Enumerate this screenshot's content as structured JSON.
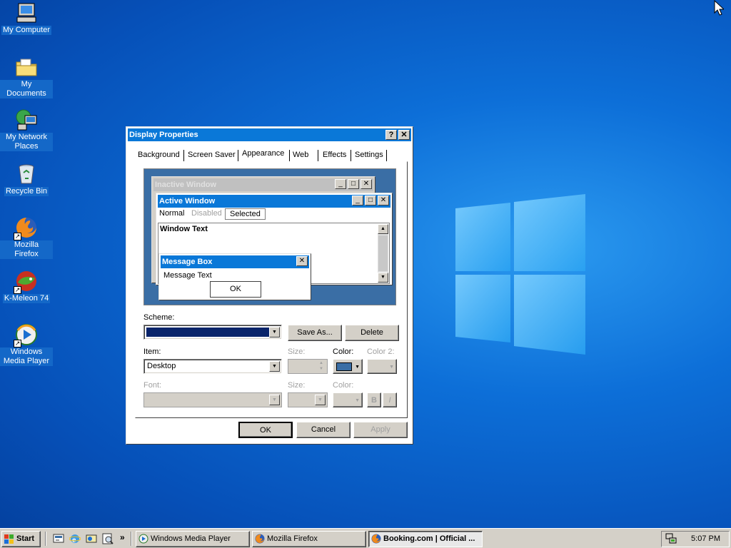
{
  "desktop": {
    "icons": [
      {
        "label": "My Computer",
        "icon": "computer-icon"
      },
      {
        "label": "My Documents",
        "icon": "folder-icon"
      },
      {
        "label": "My Network Places",
        "icon": "network-icon"
      },
      {
        "label": "Recycle Bin",
        "icon": "recycle-bin-icon"
      },
      {
        "label": "Mozilla Firefox",
        "icon": "firefox-icon"
      },
      {
        "label": "K-Meleon 74",
        "icon": "k-meleon-icon"
      },
      {
        "label": "Windows Media Player",
        "icon": "media-player-icon"
      }
    ]
  },
  "dialog": {
    "title": "Display Properties",
    "help_btn": "?",
    "close_btn": "✕",
    "tabs": [
      "Background",
      "Screen Saver",
      "Appearance",
      "Web",
      "Effects",
      "Settings"
    ],
    "active_tab": "Appearance",
    "preview": {
      "inactive_title": "Inactive Window",
      "active_title": "Active Window",
      "menu": [
        "Normal",
        "Disabled",
        "Selected"
      ],
      "window_text": "Window Text",
      "msgbox_title": "Message Box",
      "msgbox_text": "Message Text",
      "msgbox_ok": "OK"
    },
    "scheme_label": "Scheme:",
    "scheme_value": "",
    "save_as": "Save As...",
    "delete": "Delete",
    "item_label": "Item:",
    "item_value": "Desktop",
    "size_label": "Size:",
    "color_label": "Color:",
    "color2_label": "Color 2:",
    "font_label": "Font:",
    "size2_label": "Size:",
    "color3_label": "Color:",
    "bold": "B",
    "italic": "I",
    "ok": "OK",
    "cancel": "Cancel",
    "apply": "Apply"
  },
  "taskbar": {
    "start": "Start",
    "quick_launch": [
      "show-desktop-icon",
      "internet-explorer-icon",
      "outlook-icon",
      "search-icon"
    ],
    "more": "»",
    "tasks": [
      {
        "label": "Windows Media Player",
        "icon": "media-player-icon",
        "active": false
      },
      {
        "label": "Mozilla Firefox",
        "icon": "firefox-icon",
        "active": false
      },
      {
        "label": "Booking.com | Official ...",
        "icon": "firefox-icon",
        "active": true
      }
    ],
    "clock": "5:07 PM"
  },
  "colors": {
    "desktop": "#0d6fd8",
    "titlebar": "#0a78d8",
    "scheme_swatch": "#0a246a",
    "preview_bg": "#3a6ea5",
    "color_swatch": "#3a6ea5"
  }
}
